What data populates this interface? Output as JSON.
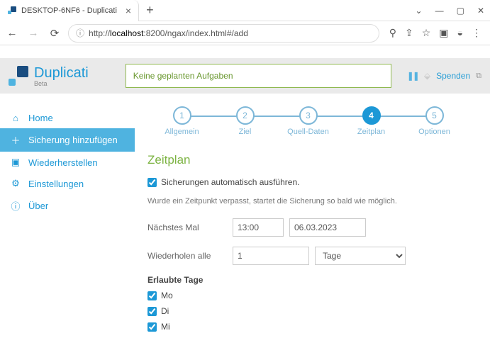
{
  "browser": {
    "tab_title": "DESKTOP-6NF6 - Duplicati",
    "url_prefix": "http://",
    "url_host": "localhost",
    "url_rest": ":8200/ngax/index.html#/add"
  },
  "header": {
    "brand": "Duplicati",
    "brand_sub": "Beta",
    "status": "Keine geplanten Aufgaben",
    "donate": "Spenden"
  },
  "sidebar": {
    "items": [
      {
        "label": "Home"
      },
      {
        "label": "Sicherung hinzufügen"
      },
      {
        "label": "Wiederherstellen"
      },
      {
        "label": "Einstellungen"
      },
      {
        "label": "Über"
      }
    ]
  },
  "stepper": {
    "steps": [
      {
        "num": "1",
        "label": "Allgemein"
      },
      {
        "num": "2",
        "label": "Ziel"
      },
      {
        "num": "3",
        "label": "Quell-Daten"
      },
      {
        "num": "4",
        "label": "Zeitplan"
      },
      {
        "num": "5",
        "label": "Optionen"
      }
    ]
  },
  "schedule": {
    "title": "Zeitplan",
    "auto_label": "Sicherungen automatisch ausführen.",
    "auto_checked": true,
    "hint": "Wurde ein Zeitpunkt verpasst, startet die Sicherung so bald wie möglich.",
    "next_label": "Nächstes Mal",
    "next_time": "13:00",
    "next_date": "06.03.2023",
    "repeat_label": "Wiederholen alle",
    "repeat_value": "1",
    "repeat_unit": "Tage",
    "days_title": "Erlaubte Tage",
    "days": [
      {
        "label": "Mo",
        "checked": true
      },
      {
        "label": "Di",
        "checked": true
      },
      {
        "label": "Mi",
        "checked": true
      }
    ]
  }
}
